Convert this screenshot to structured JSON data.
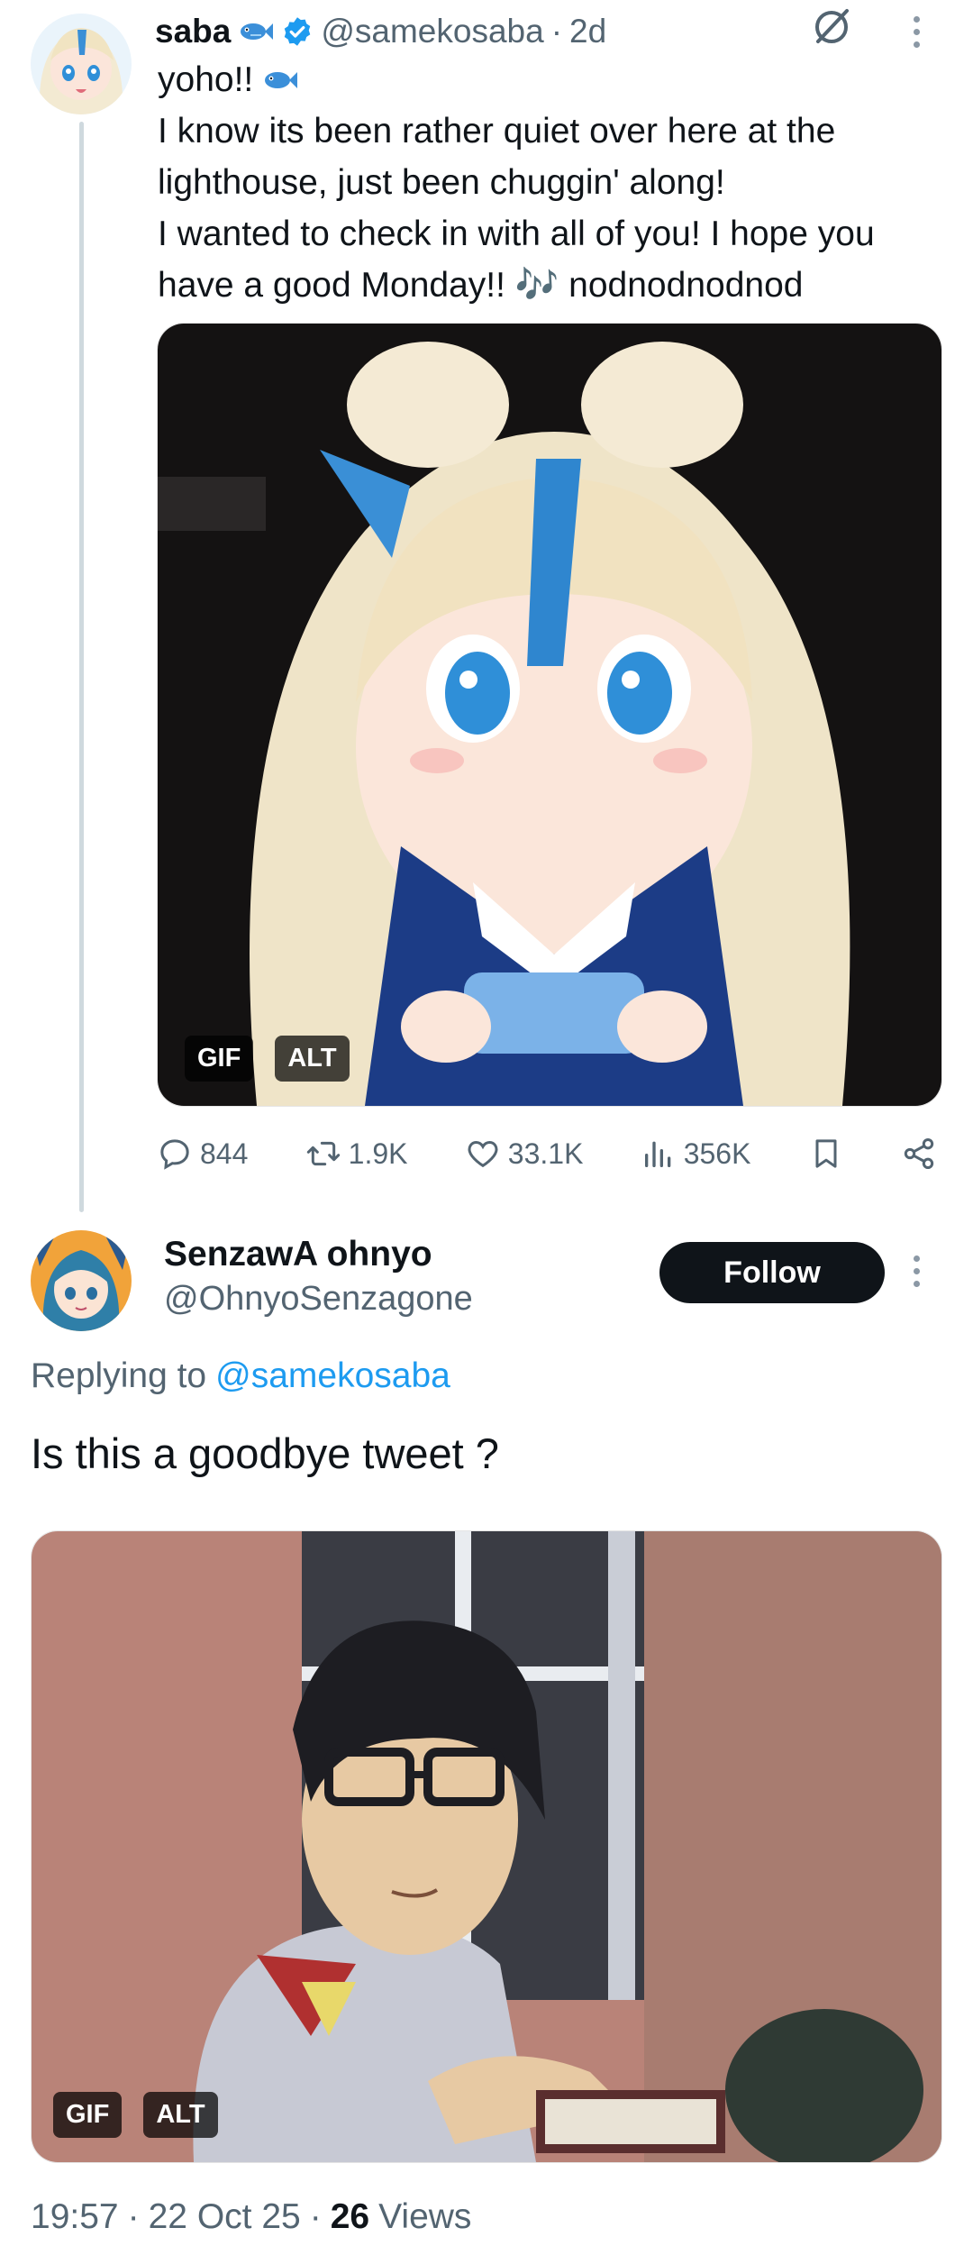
{
  "tweet": {
    "display_name": "saba",
    "handle": "@samekosaba",
    "time_sep": "·",
    "time": "2d",
    "text_line1": "yoho!!",
    "text_rest": "I know its been rather quiet over here at the lighthouse, just been chuggin' along!\nI wanted to check in with all of you! I hope you have a good Monday!! 🎶 nodnodnodnod",
    "media_badges": {
      "gif": "GIF",
      "alt": "ALT"
    },
    "stats": {
      "replies": "844",
      "reposts": "1.9K",
      "likes": "33.1K",
      "views": "356K"
    }
  },
  "reply": {
    "display_name": "SenzawA ohnyo",
    "handle": "@OhnyoSenzagone",
    "follow_label": "Follow",
    "replying_prefix": "Replying to",
    "replying_handle": "@samekosaba",
    "text": "Is this a goodbye tweet ?",
    "media_badges": {
      "gif": "GIF",
      "alt": "ALT"
    },
    "meta": {
      "time": "19:57",
      "sep1": "·",
      "date": "22 Oct 25",
      "sep2": "·",
      "views_count": "26",
      "views_label": "Views"
    }
  },
  "colors": {
    "accent": "#1d9bf0",
    "text": "#0f1419",
    "secondary": "#536471",
    "thread_line": "#cfd9de"
  },
  "icons": [
    "fish-emoji-icon",
    "verified-badge-icon",
    "grok-icon",
    "more-icon",
    "reply-icon",
    "repost-icon",
    "like-icon",
    "views-icon",
    "bookmark-icon",
    "share-icon"
  ]
}
